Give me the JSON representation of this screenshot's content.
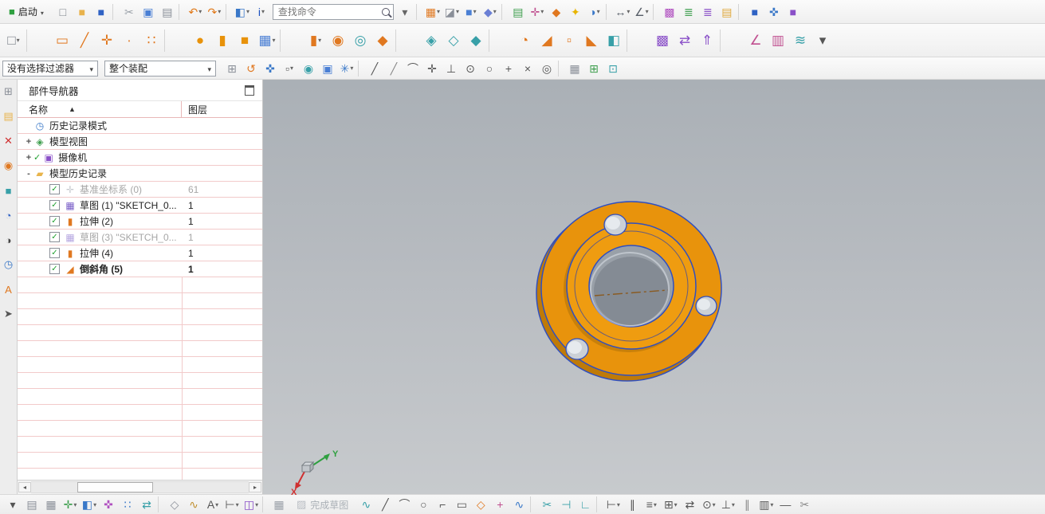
{
  "toolbars": {
    "start_label": "启动",
    "start_icon": "■",
    "find_placeholder": "查找命令",
    "selection_filter": "没有选择过滤器",
    "whole_assembly": "整个装配",
    "row1a": [
      {
        "n": "new-file-icon",
        "g": "□",
        "c": "#7A8088"
      },
      {
        "n": "open-folder-icon",
        "g": "■",
        "c": "#E8B24C"
      },
      {
        "n": "save-icon",
        "g": "■",
        "c": "#2F62C4"
      },
      {
        "n": "separator",
        "cls": "sep",
        "i": "false"
      },
      {
        "n": "cut-icon",
        "g": "✂",
        "c": "#9AA0A8"
      },
      {
        "n": "copy-icon",
        "g": "▣",
        "c": "#4A7FD4"
      },
      {
        "n": "paste-icon",
        "g": "▤",
        "c": "#8A8F98"
      },
      {
        "n": "separator",
        "cls": "sep",
        "i": "false"
      },
      {
        "n": "undo-icon",
        "g": "↶",
        "c": "#E07818",
        "cls": "dd"
      },
      {
        "n": "redo-icon",
        "g": "↷",
        "c": "#E07818",
        "cls": "dd"
      },
      {
        "n": "separator",
        "cls": "sep",
        "i": "false"
      },
      {
        "n": "format-painter-icon",
        "g": "◧",
        "c": "#3A78C8",
        "cls": "dd"
      },
      {
        "n": "info-icon",
        "g": "i",
        "c": "#1A50C0",
        "cls": "dd"
      }
    ],
    "row1b": [
      {
        "n": "search-dropdown-icon",
        "g": "▾",
        "c": "#666666"
      },
      {
        "n": "separator",
        "cls": "sep",
        "i": "false"
      },
      {
        "n": "window-display-icon",
        "g": "▦",
        "c": "#E07820",
        "cls": "dd"
      },
      {
        "n": "show-hide-icon",
        "g": "◪",
        "c": "#8A8F98",
        "cls": "dd"
      },
      {
        "n": "view-cube-icon",
        "g": "■",
        "c": "#4A7FD4",
        "cls": "dd"
      },
      {
        "n": "render-style-icon",
        "g": "◆",
        "c": "#6A7FD4",
        "cls": "dd"
      },
      {
        "n": "separator",
        "cls": "sep",
        "i": "false"
      },
      {
        "n": "sheet-icon",
        "g": "▤",
        "c": "#3F9F4F"
      },
      {
        "n": "csys-display-icon",
        "g": "✛",
        "c": "#C05090",
        "cls": "dd"
      },
      {
        "n": "true-shading-icon",
        "g": "◆",
        "c": "#E07820"
      },
      {
        "n": "spark-icon",
        "g": "✦",
        "c": "#E8B400"
      },
      {
        "n": "edit-section-icon",
        "g": "◑",
        "c": "#3A78C8",
        "cls": "dd"
      },
      {
        "n": "separator",
        "cls": "sep",
        "i": "false"
      },
      {
        "n": "measure-distance-icon",
        "g": "↔",
        "c": "#555C66",
        "cls": "dd"
      },
      {
        "n": "measure-angle-icon",
        "g": "∠",
        "c": "#555C66",
        "cls": "dd"
      },
      {
        "n": "separator",
        "cls": "sep",
        "i": "false"
      },
      {
        "n": "pattern-display-icon",
        "g": "▩",
        "c": "#B050C0"
      },
      {
        "n": "layer-settings-icon",
        "g": "≣",
        "c": "#3F9F4F"
      },
      {
        "n": "layer-category-icon",
        "g": "≣",
        "c": "#8A50C8"
      },
      {
        "n": "notebook-icon",
        "g": "▤",
        "c": "#E0A83C"
      },
      {
        "n": "separator",
        "cls": "sep",
        "i": "false"
      },
      {
        "n": "assembly-cube-icon",
        "g": "■",
        "c": "#2F62C4"
      },
      {
        "n": "move-component-icon",
        "g": "✜",
        "c": "#3A78C8"
      },
      {
        "n": "constraint-cube-icon",
        "g": "■",
        "c": "#8A50C8"
      }
    ],
    "row2": [
      {
        "n": "sketch-task-icon",
        "g": "□",
        "c": "#7A8088",
        "cls": "dd"
      },
      {
        "n": "separator",
        "cls": "sep",
        "i": "false"
      },
      {
        "n": "datum-plane-icon",
        "g": "▭",
        "c": "#E07820"
      },
      {
        "n": "datum-axis-icon",
        "g": "╱",
        "c": "#E07820"
      },
      {
        "n": "datum-csys-icon",
        "g": "✛",
        "c": "#E07820"
      },
      {
        "n": "point-icon",
        "g": "∙",
        "c": "#E07820"
      },
      {
        "n": "point-set-icon",
        "g": "∷",
        "c": "#E07820"
      },
      {
        "n": "separator",
        "cls": "sep",
        "i": "false"
      },
      {
        "n": "sphere-icon",
        "g": "●",
        "c": "#E8920A"
      },
      {
        "n": "cylinder-icon",
        "g": "▮",
        "c": "#E8920A"
      },
      {
        "n": "block-icon",
        "g": "■",
        "c": "#E8920A"
      },
      {
        "n": "sketch-icon",
        "g": "▦",
        "c": "#4A7FD4",
        "cls": "dd"
      },
      {
        "n": "separator",
        "cls": "sep",
        "i": "false"
      },
      {
        "n": "extrude-icon",
        "g": "▮",
        "c": "#E07820",
        "cls": "dd"
      },
      {
        "n": "revolve-icon",
        "g": "◉",
        "c": "#E07820"
      },
      {
        "n": "hole-icon",
        "g": "◎",
        "c": "#38A0A8"
      },
      {
        "n": "rib-icon",
        "g": "◆",
        "c": "#E07820"
      },
      {
        "n": "separator",
        "cls": "sep",
        "i": "false"
      },
      {
        "n": "unite-icon",
        "g": "◈",
        "c": "#38A0A8"
      },
      {
        "n": "subtract-icon",
        "g": "◇",
        "c": "#38A0A8"
      },
      {
        "n": "intersect-icon",
        "g": "◆",
        "c": "#38A0A8"
      },
      {
        "n": "separator",
        "cls": "sep",
        "i": "false"
      },
      {
        "n": "edge-blend-icon",
        "g": "◔",
        "c": "#E07820"
      },
      {
        "n": "chamfer-icon",
        "g": "◢",
        "c": "#E07820"
      },
      {
        "n": "shell-icon",
        "g": "▫",
        "c": "#E07820"
      },
      {
        "n": "draft-icon",
        "g": "◣",
        "c": "#E07820"
      },
      {
        "n": "trim-body-icon",
        "g": "◧",
        "c": "#38A0A8"
      },
      {
        "n": "separator",
        "cls": "sep",
        "i": "false"
      },
      {
        "n": "pattern-feature-icon",
        "g": "▩",
        "c": "#8A50C8"
      },
      {
        "n": "mirror-feature-icon",
        "g": "⇄",
        "c": "#8A50C8"
      },
      {
        "n": "offset-face-icon",
        "g": "⇑",
        "c": "#8A50C8"
      },
      {
        "n": "separator",
        "cls": "sep",
        "i": "false"
      },
      {
        "n": "measure-body-icon",
        "g": "∠",
        "c": "#C05090"
      },
      {
        "n": "section-view-icon",
        "g": "▥",
        "c": "#C05090"
      },
      {
        "n": "wave-link-icon",
        "g": "≋",
        "c": "#38A0A8"
      },
      {
        "n": "more-features-icon",
        "g": "▾",
        "c": "#555555"
      }
    ],
    "row3": [
      {
        "n": "snap-settings-icon",
        "g": "⊞",
        "c": "#8A8F98"
      },
      {
        "n": "reset-orientation-icon",
        "g": "↺",
        "c": "#E07820"
      },
      {
        "n": "drag-handle-icon",
        "g": "✜",
        "c": "#3A78C8"
      },
      {
        "n": "marquee-icon",
        "g": "▫",
        "c": "#555555",
        "cls": "dd"
      },
      {
        "n": "highlight-icon",
        "g": "◉",
        "c": "#38A0A8"
      },
      {
        "n": "shaded-view-icon",
        "g": "▣",
        "c": "#4A7FD4"
      },
      {
        "n": "snap-star-icon",
        "g": "✳",
        "c": "#3A78C8",
        "cls": "dd"
      },
      {
        "n": "separator",
        "cls": "sep",
        "i": "false"
      },
      {
        "n": "snap-endpoint-icon",
        "g": "╱",
        "c": "#555555"
      },
      {
        "n": "snap-line-icon",
        "g": "╱",
        "c": "#888888"
      },
      {
        "n": "snap-arc-icon",
        "g": "⌒",
        "c": "#555555"
      },
      {
        "n": "snap-midpoint-icon",
        "g": "✛",
        "c": "#555555"
      },
      {
        "n": "snap-perpendicular-icon",
        "g": "⊥",
        "c": "#555555"
      },
      {
        "n": "snap-center-icon",
        "g": "⊙",
        "c": "#555555"
      },
      {
        "n": "snap-circle-icon",
        "g": "○",
        "c": "#555555"
      },
      {
        "n": "snap-point-icon",
        "g": "+",
        "c": "#555555"
      },
      {
        "n": "snap-intersection-icon",
        "g": "×",
        "c": "#555555"
      },
      {
        "n": "snap-on-curve-icon",
        "g": "◎",
        "c": "#555555"
      },
      {
        "n": "separator",
        "cls": "sep",
        "i": "false"
      },
      {
        "n": "grid-icon",
        "g": "▦",
        "c": "#8A8F98"
      },
      {
        "n": "work-plane-icon",
        "g": "⊞",
        "c": "#3F9F4F"
      },
      {
        "n": "view-section-icon",
        "g": "⊡",
        "c": "#38A0A8"
      }
    ]
  },
  "leftstrip": [
    {
      "n": "touch-mode-icon",
      "g": "⊞",
      "c": "#8A8F98"
    },
    {
      "n": "assembly-navigator-icon",
      "g": "▤",
      "c": "#E8B24C"
    },
    {
      "n": "constraint-navigator-icon",
      "g": "✕",
      "c": "#D03030"
    },
    {
      "n": "part-navigator-icon",
      "g": "◉",
      "c": "#E07820"
    },
    {
      "n": "reuse-library-icon",
      "g": "■",
      "c": "#38A0A8"
    },
    {
      "n": "web-browser-icon",
      "g": "◔",
      "c": "#2F62C4"
    },
    {
      "n": "history-icon",
      "g": "◑",
      "c": "#444444"
    },
    {
      "n": "clock-icon",
      "g": "◷",
      "c": "#3A78C8"
    },
    {
      "n": "materials-icon",
      "g": "A",
      "c": "#E07820"
    },
    {
      "n": "process-icon",
      "g": "➤",
      "c": "#555555"
    }
  ],
  "navigator": {
    "title": "部件导航器",
    "columns": [
      "名称",
      "图层"
    ],
    "items": [
      {
        "ig": "◷",
        "icc": "#3A78C8",
        "label": "历史记录模式"
      },
      {
        "exp": "+",
        "ig": "◈",
        "icc": "#3F9F4F",
        "label": "模型视图"
      },
      {
        "exp": "+",
        "pre": "1",
        "ig": "▣",
        "icc": "#8A50C8",
        "label": "摄像机"
      },
      {
        "exp": "-",
        "ig": "▰",
        "icc": "#E8B44C",
        "label": "模型历史记录"
      },
      {
        "chk": "1",
        "ind": "1",
        "ig": "✛",
        "icc": "#9AA0A8",
        "label": "基准坐标系 (0)",
        "layer": "61",
        "cls": "grayed"
      },
      {
        "chk": "1",
        "ind": "1",
        "ig": "▦",
        "icc": "#7A5FC8",
        "label": "草图 (1) \"SKETCH_0...",
        "layer": "1"
      },
      {
        "chk": "1",
        "ind": "1",
        "ig": "▮",
        "icc": "#E07820",
        "label": "拉伸 (2)",
        "layer": "1"
      },
      {
        "chk": "1",
        "ind": "1",
        "ig": "▦",
        "icc": "#7A5FC8",
        "label": "草图 (3) \"SKETCH_0...",
        "layer": "1",
        "cls": "grayed"
      },
      {
        "chk": "1",
        "ind": "1",
        "ig": "▮",
        "icc": "#E07820",
        "label": "拉伸 (4)",
        "layer": "1"
      },
      {
        "chk": "1",
        "ind": "1",
        "ig": "◢",
        "icc": "#E07820",
        "label": "倒斜角 (5)",
        "layer": "1",
        "cls": "bold"
      }
    ]
  },
  "viewport": {
    "part": {
      "body_color": "#E8930C",
      "shadow_color": "#BF7A08",
      "boss_color": "#EF9C10",
      "edge_color": "#2F4FC0",
      "bore_color": "#99A0A8",
      "hole_color": "#CBD0D6",
      "centerline_color": "#8A5A20"
    },
    "triad": {
      "x_label": "X",
      "y_label": "Y",
      "x_color": "#D03030",
      "y_color": "#2FA040"
    }
  },
  "bottom": {
    "finish_label": "完成草图",
    "finish_icon": "▨",
    "a": [
      {
        "n": "menu-chevron-icon",
        "g": "▾",
        "c": "#555555"
      },
      {
        "n": "clipboard-icon",
        "g": "▤",
        "c": "#8A8F98"
      },
      {
        "n": "window-grid-icon",
        "g": "▦",
        "c": "#8A8F98"
      },
      {
        "n": "add-component-icon",
        "g": "✛",
        "c": "#3F9F4F",
        "cls": "dd"
      },
      {
        "n": "move-component2-icon",
        "g": "◧",
        "c": "#3A78C8",
        "cls": "dd"
      },
      {
        "n": "assembly-constraints-icon",
        "g": "✜",
        "c": "#B050C0"
      },
      {
        "n": "pattern-component-icon",
        "g": "∷",
        "c": "#3A78C8"
      },
      {
        "n": "mirror-assembly-icon",
        "g": "⇄",
        "c": "#38A0A8"
      },
      {
        "n": "separator",
        "cls": "sep",
        "i": "false"
      },
      {
        "n": "datum-display-icon",
        "g": "◇",
        "c": "#8A8F98"
      },
      {
        "n": "spline-tool-icon",
        "g": "∿",
        "c": "#C09030"
      },
      {
        "n": "text-tool-icon",
        "g": "A",
        "c": "#555555",
        "cls": "dd"
      },
      {
        "n": "dimension-tool-icon",
        "g": "⊢",
        "c": "#555555",
        "cls": "dd"
      },
      {
        "n": "block-add-icon",
        "g": "◫",
        "c": "#8A50C8",
        "cls": "dd"
      },
      {
        "n": "separator",
        "cls": "sep",
        "i": "false"
      },
      {
        "n": "checker-map-icon",
        "g": "▦",
        "c": "#9AA0A8"
      }
    ],
    "b": [
      {
        "n": "profile-icon",
        "g": "∿",
        "c": "#38A0A8"
      },
      {
        "n": "line-icon",
        "g": "╱",
        "c": "#555555"
      },
      {
        "n": "arc-icon",
        "g": "⌒",
        "c": "#555555"
      },
      {
        "n": "circle-icon",
        "g": "○",
        "c": "#555555"
      },
      {
        "n": "fillet-icon",
        "g": "⌐",
        "c": "#555555"
      },
      {
        "n": "rectangle-icon",
        "g": "▭",
        "c": "#555555"
      },
      {
        "n": "polygon-icon",
        "g": "◇",
        "c": "#E07820"
      },
      {
        "n": "point-tool-icon",
        "g": "+",
        "c": "#C05090"
      },
      {
        "n": "studio-spline-icon",
        "g": "∿",
        "c": "#3A78C8"
      },
      {
        "n": "separator",
        "cls": "sep",
        "i": "false"
      },
      {
        "n": "quick-trim-icon",
        "g": "✂",
        "c": "#38A0A8"
      },
      {
        "n": "quick-extend-icon",
        "g": "⊣",
        "c": "#38A0A8"
      },
      {
        "n": "make-corner-icon",
        "g": "∟",
        "c": "#38A0A8"
      },
      {
        "n": "separator",
        "cls": "sep",
        "i": "false"
      },
      {
        "n": "rapid-dimension-icon",
        "g": "⊢",
        "c": "#555555",
        "cls": "dd"
      },
      {
        "n": "geometric-constraint-icon",
        "g": "∥",
        "c": "#555555"
      },
      {
        "n": "show-constraints-icon",
        "g": "≡",
        "c": "#555555",
        "cls": "dd"
      },
      {
        "n": "pattern-curve-icon",
        "g": "⊞",
        "c": "#555555",
        "cls": "dd"
      },
      {
        "n": "mirror-curve-icon",
        "g": "⇄",
        "c": "#555555"
      },
      {
        "n": "offset-curve-icon",
        "g": "⊙",
        "c": "#555555",
        "cls": "dd"
      },
      {
        "n": "measure-bottom-icon",
        "g": "⊥",
        "c": "#555555",
        "cls": "dd"
      },
      {
        "n": "parallel-lines-icon",
        "g": "∥",
        "c": "#888888"
      },
      {
        "n": "columns-icon",
        "g": "▥",
        "c": "#555555",
        "cls": "dd"
      },
      {
        "n": "continuity-icon",
        "g": "—",
        "c": "#555555"
      },
      {
        "n": "edit-curve-icon",
        "g": "✂",
        "c": "#888888"
      }
    ]
  }
}
